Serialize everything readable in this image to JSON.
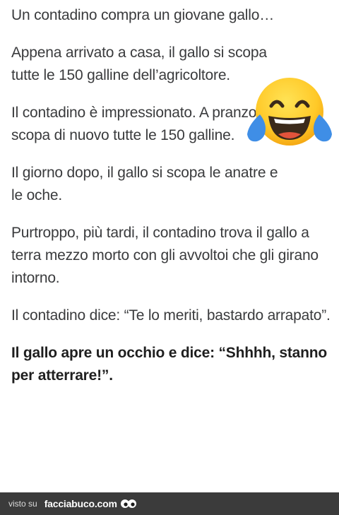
{
  "post": {
    "paragraphs": [
      "Un contadino compra un giovane gallo…",
      "Appena arrivato a casa, il gallo si scopa tutte le 150 galline dell’agricoltore.",
      "Il contadino è impressionato. A pranzo, il gallo si scopa di nuovo tutte le 150 galline.",
      "Il giorno dopo, il gallo si scopa le anatre e le oche.",
      "Purtroppo, più tardi, il contadino trova il gallo a terra mezzo morto con gli avvoltoi che gli girano intorno.",
      "Il contadino dice: “Te lo meriti, bastardo arrapato”.",
      "Il gallo apre un occhio e dice: “Shhhh, stanno per atterrare!”."
    ],
    "emoji": "face-with-tears-of-joy-icon"
  },
  "footer": {
    "visto_label": "visto su",
    "site": "facciabuco.com",
    "logo": "facciabuco-eyes-logo"
  }
}
